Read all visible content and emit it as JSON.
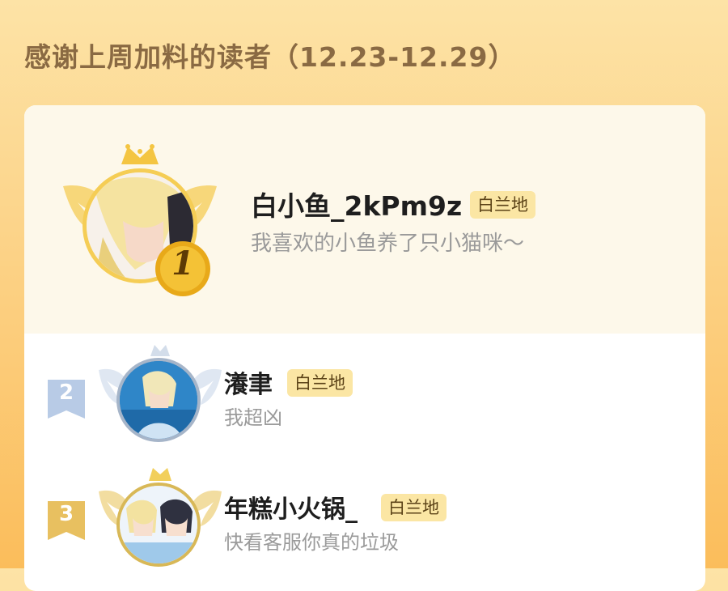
{
  "header": {
    "title": "感谢上周加料的读者（12.23-12.29）"
  },
  "colors": {
    "accent": "#fbbd5b",
    "badge_bg": "#fbe6a4",
    "gold": "#f2c64a",
    "silver": "#b6c8e3"
  },
  "readers": [
    {
      "rank": "1",
      "name": "白小鱼_2kPm9z",
      "badge": "白兰地",
      "message": "我喜欢的小鱼养了只小猫咪～"
    },
    {
      "rank": "2",
      "name": "瀁聿",
      "badge": "白兰地",
      "message": "我超凶"
    },
    {
      "rank": "3",
      "name": "年糕小火锅_",
      "badge": "白兰地",
      "message": "快看客服你真的垃圾"
    }
  ]
}
